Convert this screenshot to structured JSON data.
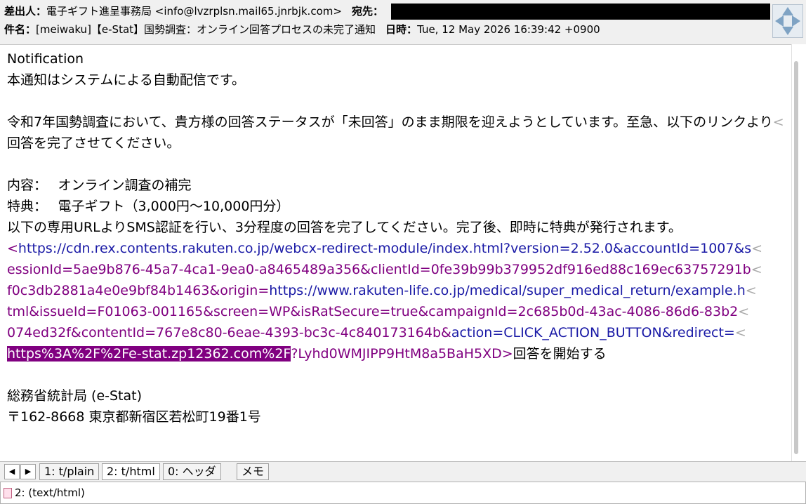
{
  "header": {
    "from_label": "差出人：",
    "from_value": "電子ギフト進呈事務局 <info@lvzrplsn.mail65.jnrbjk.com>",
    "to_label": "宛先：",
    "subject_label": "件名：",
    "subject_value": "[meiwaku]【e-Stat】国勢調査：オンライン回答プロセスの未完了通知",
    "date_label": "日時：",
    "date_value": "Tue, 12 May 2026 16:39:42 +0900"
  },
  "body": {
    "line1": "Notification",
    "line2": "本通知はシステムによる自動配信です。",
    "line3": "令和7年国勢調査において、貴方様の回答ステータスが「未回答」のまま期限を迎えようとしています。至急、以下のリンクより",
    "line4": "回答を完了させてください。",
    "line5": "内容：　 オンライン調査の補完",
    "line6": "特典：　 電子ギフト（3,000円～10,000円分）",
    "line7": "以下の専用URLよりSMS認証を行い、3分程度の回答を完了してください。完了後、即時に特典が発行されます。",
    "url1_open": "<",
    "url1": "https://cdn.rex.contents.rakuten.co.jp/webcx-redirect-module/index.html?version=2.52.0&accountId=1007&s",
    "url2": "essionId=5ae9b876-45a7-4ca1-9ea0-a8465489a356&clientId=0fe39b99b379952df916ed88c169ec63757291b",
    "url3a": "f0c3db2881a4e0e9bf84b1463&origin=",
    "url3b": "https://www.rakuten-life.co.jp/medical/super_medical_return/example.h",
    "url4": "tml&issueId=F01063-001165&screen=WP&isRatSecure=true&campaignId=2c685b0d-43ac-4086-86d6-83b2",
    "url5a": "074ed32f&contentId=767e8c80-6eae-4393-bc3c-4c840173164b&",
    "url5b": "action=CLICK_ACTION_BUTTON&redirect=",
    "url6_highlight": "https%3A%2F%2Fe-stat.zp12362.com%2F",
    "url6_rest": "?Lyhd0WMJIPP9HtM8a5BaH5XD>",
    "url6_text": "回答を開始する",
    "wrap_mark": "<",
    "footer1": "総務省統計局 (e-Stat)",
    "footer2": "〒162-8668 東京都新宿区若松町19番1号"
  },
  "tabs": {
    "prev_icon": "◀",
    "next_icon": "▶",
    "tab1": "1: t/plain",
    "tab2": "2: t/html",
    "tab3": "0: ヘッダ",
    "tab4": "メモ"
  },
  "status": {
    "text": "2: (text/html)"
  },
  "colors": {
    "link": "#800080",
    "link_blue": "#1a1aa6",
    "highlight": "#800080"
  }
}
